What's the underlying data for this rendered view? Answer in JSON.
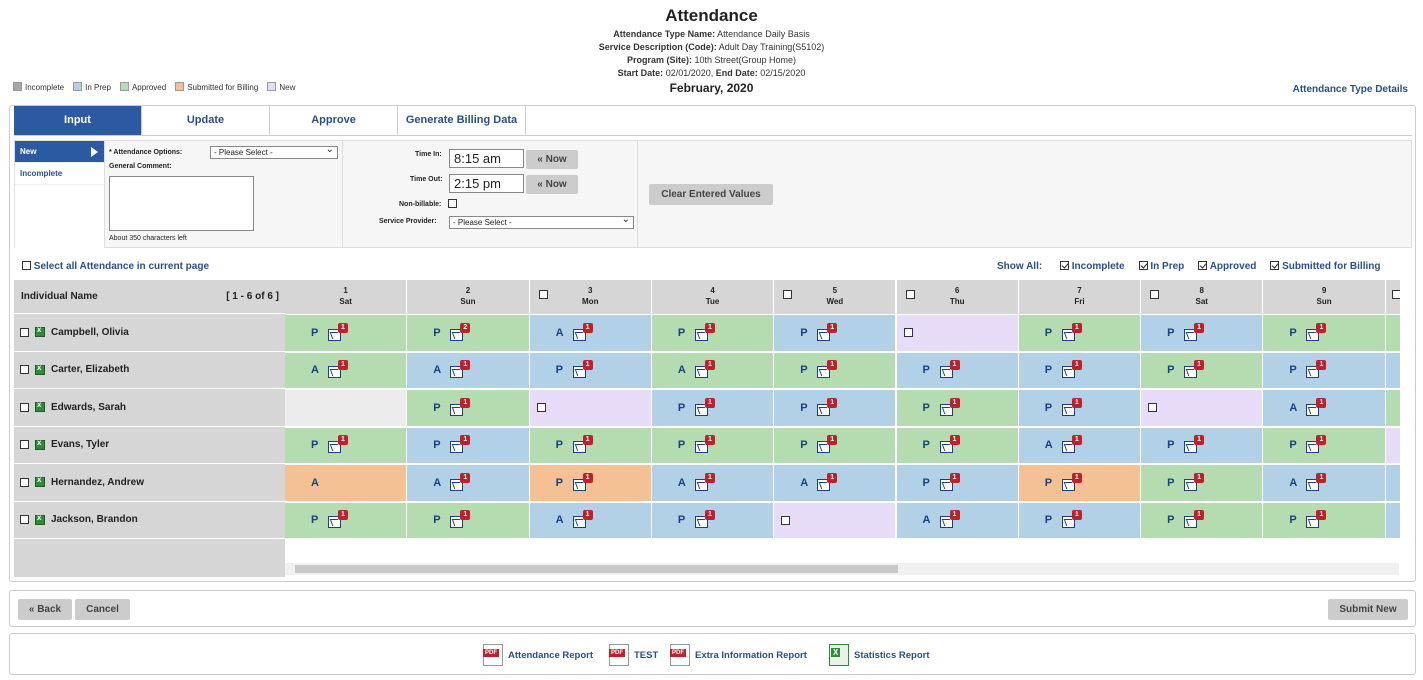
{
  "header": {
    "title": "Attendance",
    "type_label": "Attendance Type Name:",
    "type_value": "Attendance Daily Basis",
    "service_label": "Service Description (Code):",
    "service_value": "Adult Day Training(S5102)",
    "program_label": "Program (Site):",
    "program_value": "10th Street(Group Home)",
    "start_label": "Start Date:",
    "start_value": "02/01/2020,",
    "end_label": "End Date:",
    "end_value": "02/15/2020",
    "month": "February, 2020"
  },
  "legend": [
    {
      "label": "Incomplete",
      "color": "#a6a6a6"
    },
    {
      "label": "In Prep",
      "color": "#b3d1e6"
    },
    {
      "label": "Approved",
      "color": "#b5dcb1"
    },
    {
      "label": "Submitted for Billing",
      "color": "#f4c195"
    },
    {
      "label": "New",
      "color": "#e6dcf7"
    }
  ],
  "links": {
    "type_details": "Attendance Type Details"
  },
  "tabs": [
    "Input",
    "Update",
    "Approve",
    "Generate Billing Data"
  ],
  "form": {
    "left_tabs": [
      "New",
      "Incomplete"
    ],
    "attendance_options_label": "* Attendance Options:",
    "attendance_options_value": "- Please Select -",
    "general_comment_label": "General Comment:",
    "chars_left": "About 350 characters left",
    "time_in_label": "Time In:",
    "time_in_value": "8:15 am",
    "time_out_label": "Time Out:",
    "time_out_value": "2:15 pm",
    "now_label": "« Now",
    "non_billable_label": "Non-billable:",
    "service_provider_label": "Service Provider:",
    "service_provider_value": "- Please Select -",
    "clear_label": "Clear Entered Values"
  },
  "select_all_label": "Select all Attendance in current page",
  "show_all": {
    "label": "Show All:",
    "items": [
      "Incomplete",
      "In Prep",
      "Approved",
      "Submitted for Billing"
    ]
  },
  "grid": {
    "name_header": "Individual Name",
    "range": "[ 1 - 6 of 6 ]",
    "days": [
      {
        "n": "1",
        "d": "Sat",
        "chk": false
      },
      {
        "n": "2",
        "d": "Sun",
        "chk": false
      },
      {
        "n": "3",
        "d": "Mon",
        "chk": true
      },
      {
        "n": "4",
        "d": "Tue",
        "chk": false
      },
      {
        "n": "5",
        "d": "Wed",
        "chk": true
      },
      {
        "n": "6",
        "d": "Thu",
        "chk": true
      },
      {
        "n": "7",
        "d": "Fri",
        "chk": false
      },
      {
        "n": "8",
        "d": "Sat",
        "chk": true
      },
      {
        "n": "9",
        "d": "Sun",
        "chk": false
      }
    ],
    "rows": [
      {
        "name": "Campbell, Olivia",
        "cells": [
          [
            "P",
            "g",
            "1"
          ],
          [
            "P",
            "g",
            "2"
          ],
          [
            "A",
            "b",
            "1"
          ],
          [
            "P",
            "g",
            "1"
          ],
          [
            "P",
            "b",
            "1"
          ],
          [
            "",
            "v",
            ""
          ],
          [
            "P",
            "g",
            "1"
          ],
          [
            "P",
            "b",
            "1"
          ],
          [
            "P",
            "g",
            "1"
          ]
        ]
      },
      {
        "name": "Carter, Elizabeth",
        "cells": [
          [
            "A",
            "g",
            "1"
          ],
          [
            "A",
            "b",
            "1"
          ],
          [
            "P",
            "b",
            "1"
          ],
          [
            "A",
            "g",
            "1"
          ],
          [
            "P",
            "g",
            "1"
          ],
          [
            "P",
            "b",
            "1"
          ],
          [
            "P",
            "b",
            "1"
          ],
          [
            "P",
            "g",
            "1"
          ],
          [
            "P",
            "b",
            "1"
          ]
        ]
      },
      {
        "name": "Edwards, Sarah",
        "cells": [
          [
            "",
            "e",
            ""
          ],
          [
            "P",
            "g",
            "1"
          ],
          [
            "",
            "v",
            ""
          ],
          [
            "P",
            "b",
            "1"
          ],
          [
            "P",
            "b",
            "1"
          ],
          [
            "P",
            "g",
            "1"
          ],
          [
            "P",
            "b",
            "1"
          ],
          [
            "",
            "v",
            ""
          ],
          [
            "A",
            "b",
            "1"
          ]
        ]
      },
      {
        "name": "Evans, Tyler",
        "cells": [
          [
            "P",
            "g",
            "1"
          ],
          [
            "P",
            "b",
            "1"
          ],
          [
            "P",
            "g",
            "1"
          ],
          [
            "P",
            "g",
            "1"
          ],
          [
            "P",
            "g",
            "1"
          ],
          [
            "P",
            "g",
            "1"
          ],
          [
            "A",
            "b",
            "1"
          ],
          [
            "P",
            "b",
            "1"
          ],
          [
            "P",
            "g",
            "1"
          ]
        ]
      },
      {
        "name": "Hernandez, Andrew",
        "cells": [
          [
            "A",
            "o",
            ""
          ],
          [
            "A",
            "b",
            "1"
          ],
          [
            "P",
            "o",
            "1"
          ],
          [
            "A",
            "b",
            "1"
          ],
          [
            "A",
            "b",
            "1"
          ],
          [
            "P",
            "b",
            "1"
          ],
          [
            "P",
            "o",
            "1"
          ],
          [
            "P",
            "g",
            "1"
          ],
          [
            "A",
            "b",
            "1"
          ]
        ]
      },
      {
        "name": "Jackson, Brandon",
        "cells": [
          [
            "P",
            "g",
            "1"
          ],
          [
            "P",
            "g",
            "1"
          ],
          [
            "A",
            "b",
            "1"
          ],
          [
            "P",
            "b",
            "1"
          ],
          [
            "",
            "v",
            ""
          ],
          [
            "A",
            "b",
            "1"
          ],
          [
            "P",
            "b",
            "1"
          ],
          [
            "P",
            "g",
            "1"
          ],
          [
            "P",
            "g",
            "1"
          ]
        ]
      }
    ]
  },
  "buttons": {
    "back": "« Back",
    "cancel": "Cancel",
    "submit": "Submit New"
  },
  "reports": [
    "Attendance Report",
    "TEST",
    "Extra Information Report",
    "Statistics Report"
  ]
}
